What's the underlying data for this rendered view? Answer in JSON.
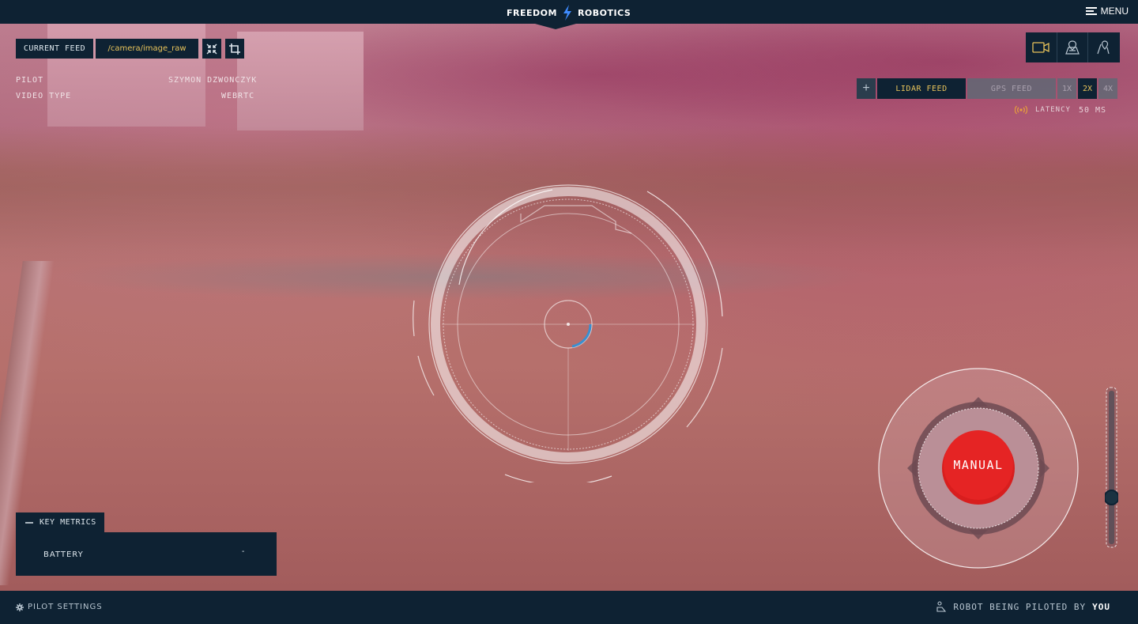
{
  "header": {
    "brand_left": "FREEDOM",
    "brand_right": "ROBOTICS",
    "menu_label": "MENU"
  },
  "feed": {
    "current_feed_label": "CURRENT FEED",
    "current_feed_value": "/camera/image_raw",
    "info": [
      {
        "label": "PILOT",
        "value": "SZYMON DZWONCZYK"
      },
      {
        "label": "VIDEO TYPE",
        "value": "WEBRTC"
      }
    ]
  },
  "controls": {
    "plus_label": "+",
    "lidar_label": "LIDAR FEED",
    "gps_label": "GPS FEED",
    "zoom_options": [
      "1X",
      "2X",
      "4X"
    ],
    "zoom_selected": "2X",
    "latency_label": "LATENCY",
    "latency_value": "50 MS"
  },
  "metrics": {
    "tab_label": "KEY METRICS",
    "items": [
      {
        "label": "BATTERY",
        "value": "-"
      }
    ]
  },
  "joystick": {
    "mode_label": "MANUAL"
  },
  "footer": {
    "pilot_settings_label": "PILOT SETTINGS",
    "piloted_by_label": "ROBOT BEING PILOTED BY",
    "piloted_by_value": "YOU"
  },
  "colors": {
    "navy": "#0e2233",
    "accent_yellow": "#e8c35a",
    "manual_red": "#d81e1e",
    "signal_orange": "#e8a03a"
  },
  "icons": {
    "top_right": [
      "video-camera-icon",
      "map-icon",
      "map-pin-icon"
    ],
    "bolt": "lightning-bolt-icon"
  }
}
